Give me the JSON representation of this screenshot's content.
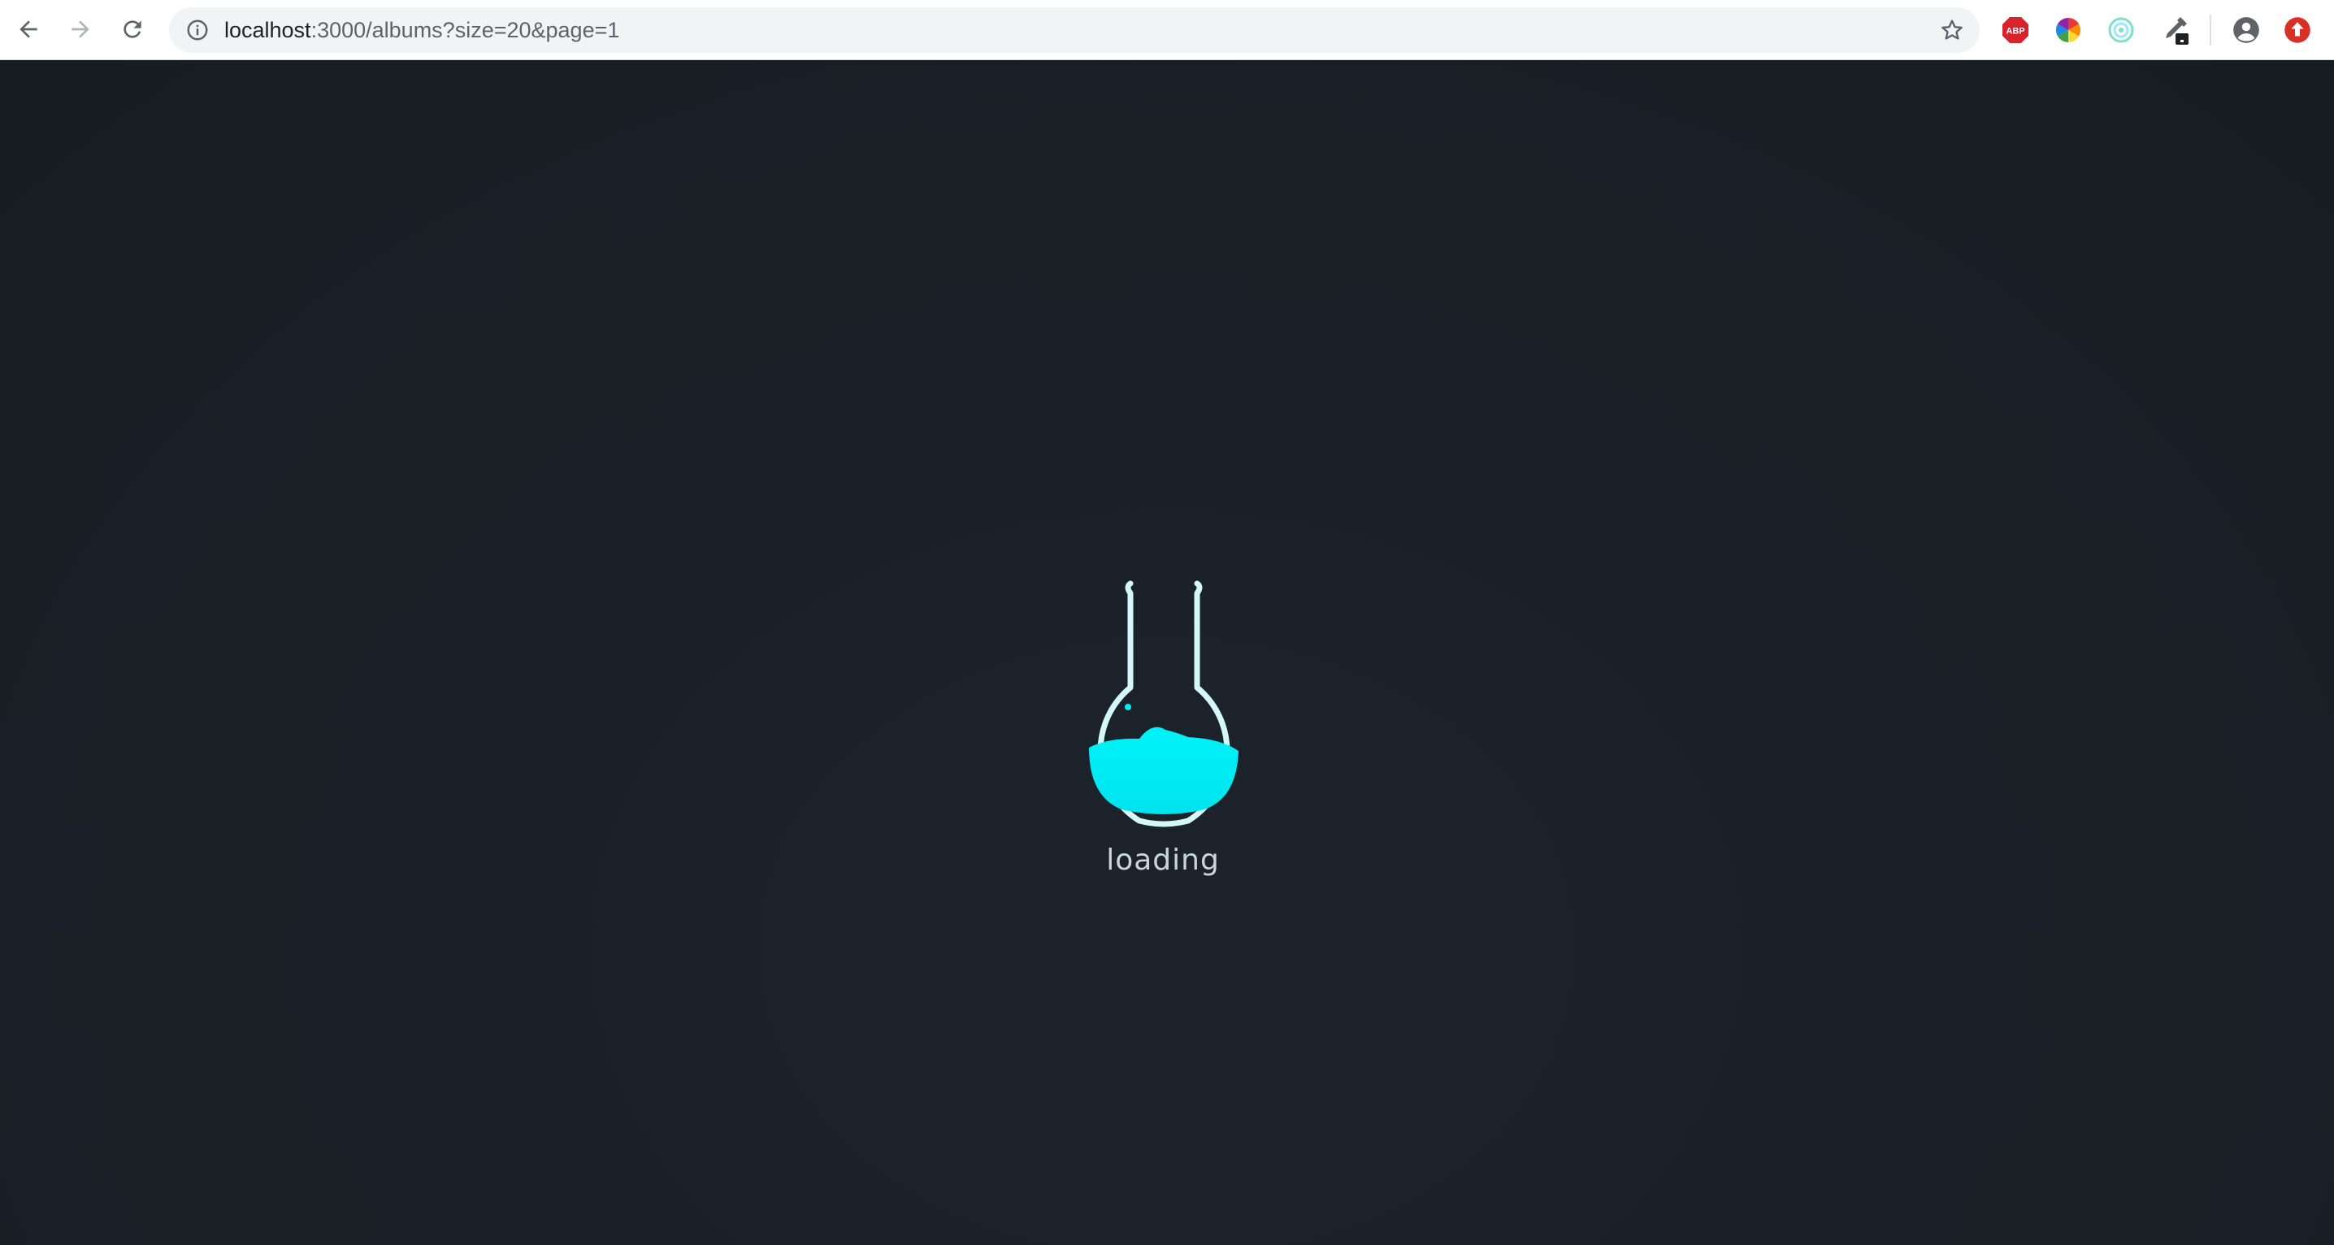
{
  "browser": {
    "url_host": "localhost",
    "url_rest": ":3000/albums?size=20&page=1",
    "back_icon": "arrow-left-icon",
    "forward_icon": "arrow-right-icon",
    "reload_icon": "reload-icon",
    "info_icon": "info-icon",
    "bookmark_icon": "star-icon",
    "extensions": [
      {
        "name": "adblock-plus-icon",
        "label": "ABP",
        "color": "#d8232a"
      },
      {
        "name": "color-wheel-icon",
        "color": "#4caf50"
      },
      {
        "name": "spiral-icon",
        "color": "#7ee0c8"
      },
      {
        "name": "eyedropper-icon",
        "color": "#5f6368"
      }
    ],
    "profile_icon": "account-circle-icon",
    "update_icon": "update-arrow-icon"
  },
  "page": {
    "loading_text": "loading",
    "loader_icon": "flask-icon",
    "accent_color": "#00eef5",
    "background_color": "#1a1f26"
  }
}
